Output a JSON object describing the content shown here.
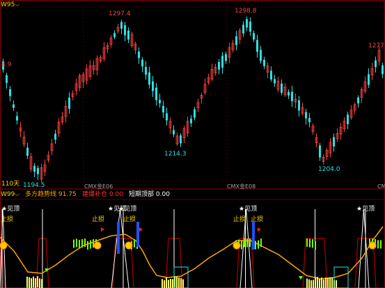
{
  "top_panel": {
    "symbol": "W95",
    "dropdown_glyph": "⌵",
    "left_value": "4.9",
    "period": "110天",
    "peaks": [
      {
        "label": "1297.4",
        "color": "#ff4040"
      },
      {
        "label": "1298.8",
        "color": "#ff4040"
      },
      {
        "label": "1277",
        "color": "#ff4040"
      }
    ],
    "troughs": [
      {
        "label": "1194.5",
        "color": "#2ee0e0"
      },
      {
        "label": "1214.3",
        "color": "#2ee0e0"
      },
      {
        "label": "1204.0",
        "color": "#2ee0e0"
      }
    ],
    "axis_marks": [
      "CMX金E06",
      "CMX金E08",
      "CM"
    ]
  },
  "bottom_panel": {
    "symbol": "W99",
    "dropdown_glyph": "⌵",
    "indicators": [
      {
        "name": "多方趋势线",
        "value": "91.75",
        "color": "#ffa500"
      },
      {
        "name": "建爆补仓",
        "value": "0.00",
        "color": "#ff3030"
      },
      {
        "name": "短期顶部",
        "value": "0.00",
        "color": "#ffffff"
      }
    ],
    "signals": [
      "★见顶",
      "★见顶",
      "★见顶",
      "★见顶",
      "★见顶"
    ],
    "stops": [
      "止损",
      "止损",
      "止损",
      "止损",
      "止损"
    ]
  },
  "colors": {
    "up": "#ff4040",
    "down": "#2ee0e0",
    "trend": "#ffa500",
    "grid": "#8b0000"
  }
}
